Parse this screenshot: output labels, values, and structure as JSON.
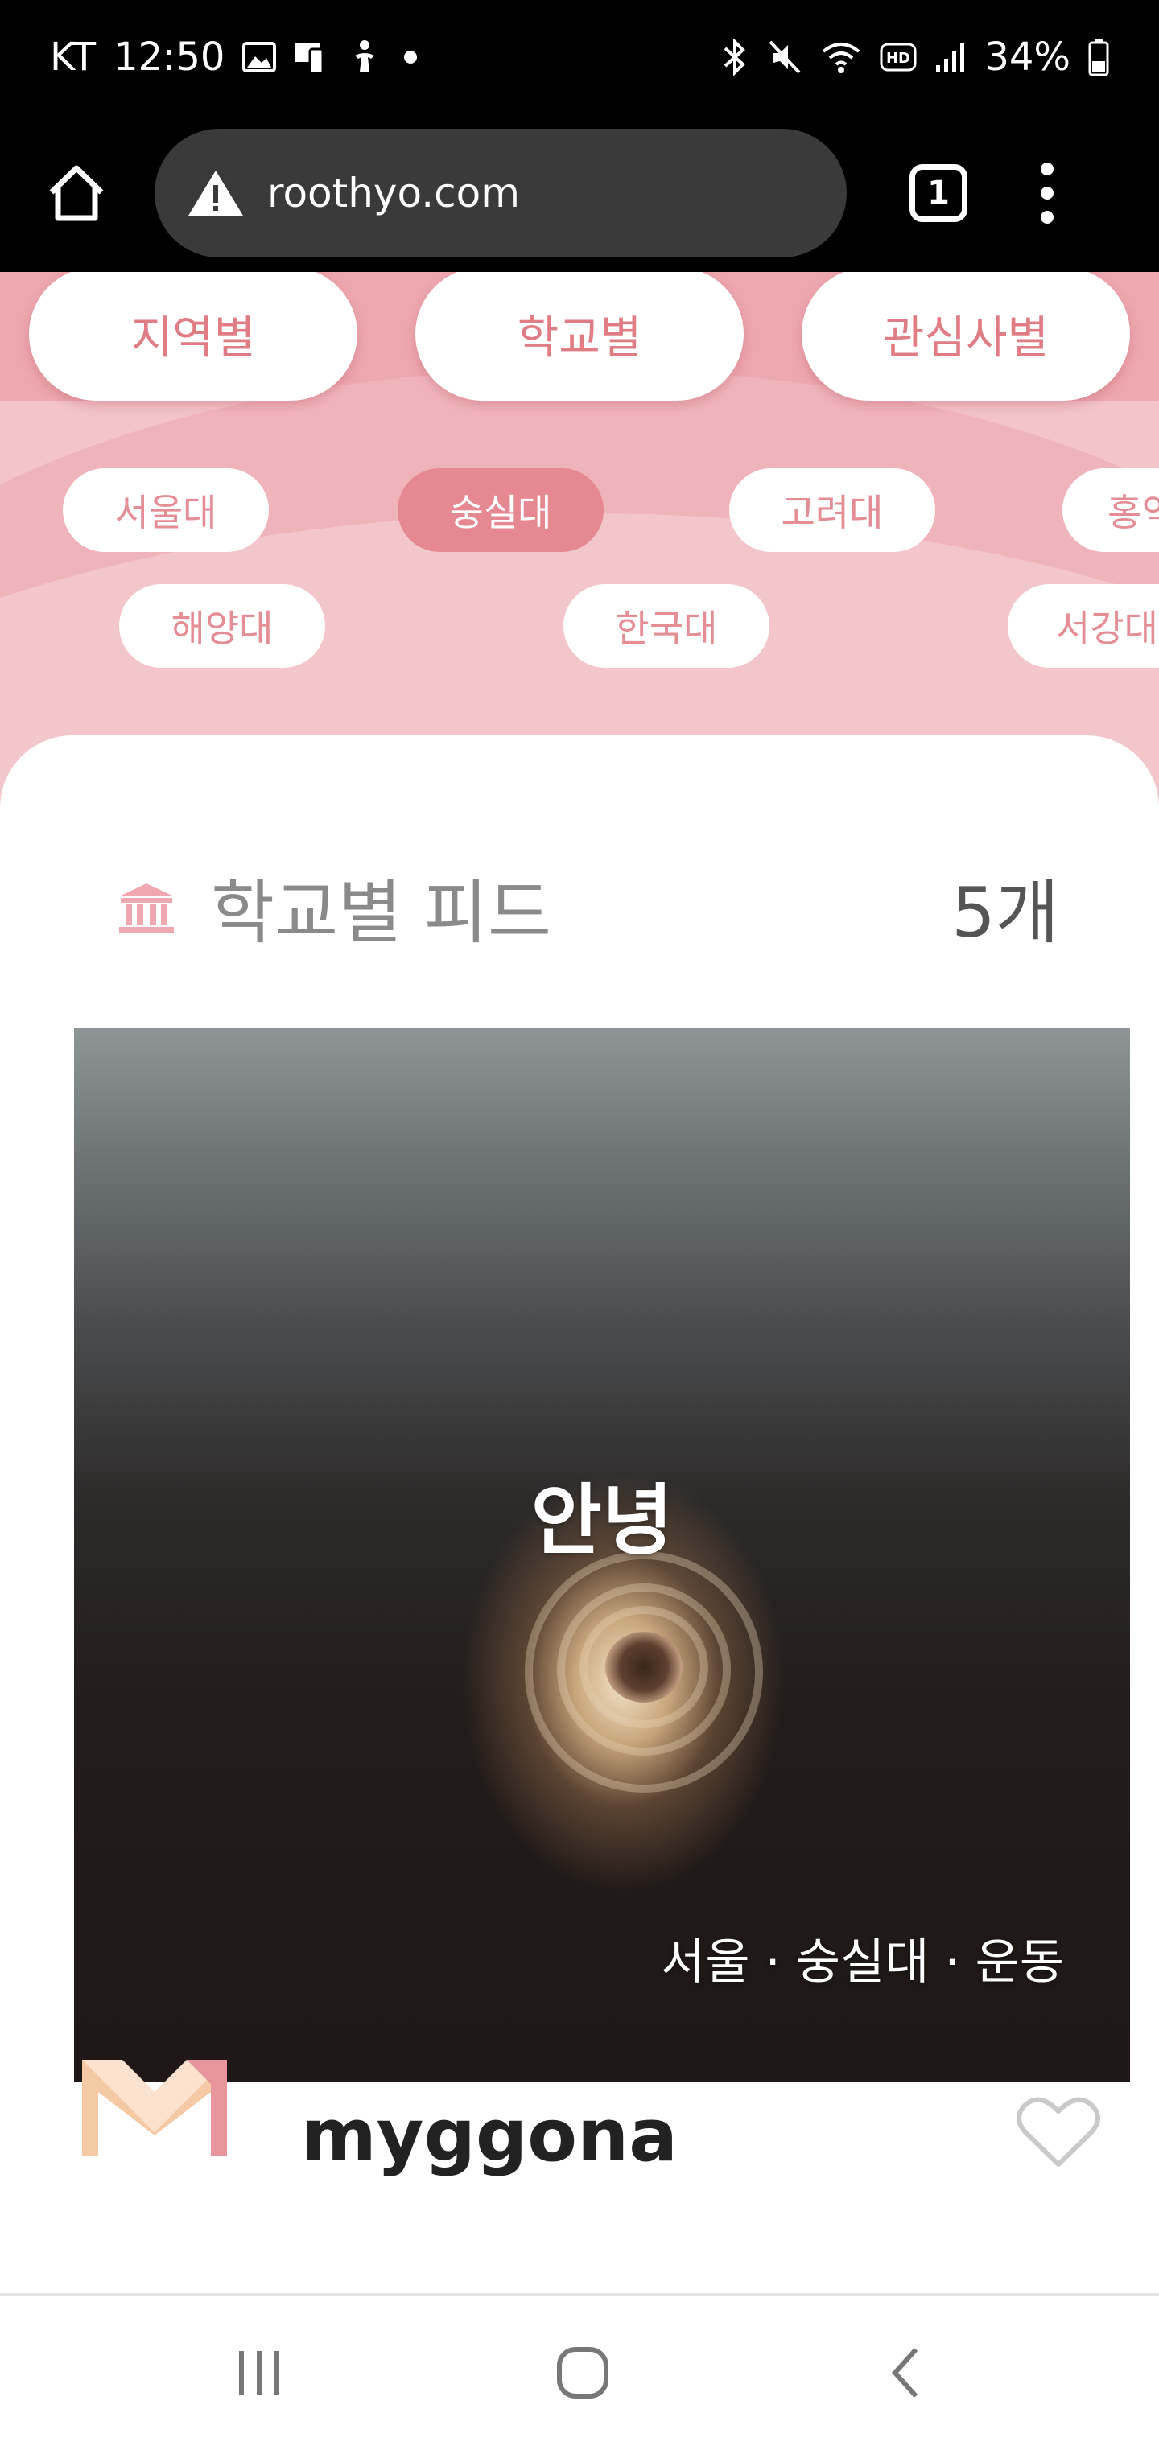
{
  "status_bar": {
    "carrier": "KT",
    "time": "12:50",
    "battery": "34%",
    "left_icons": [
      "gallery-icon",
      "screen-mirror-icon",
      "accessibility-icon",
      "notification-dot-icon"
    ],
    "right_icons": [
      "bluetooth-icon",
      "mute-icon",
      "wifi-icon",
      "hd-icon",
      "signal-icon",
      "battery-icon"
    ]
  },
  "browser": {
    "url": "roothyo.com",
    "tab_count": "1"
  },
  "filters": {
    "tabs": [
      {
        "label": "지역별"
      },
      {
        "label": "학교별"
      },
      {
        "label": "관심사별"
      }
    ],
    "chips": [
      {
        "label": "서울대",
        "active": false
      },
      {
        "label": "숭실대",
        "active": true
      },
      {
        "label": "고려대",
        "active": false
      },
      {
        "label": "홍익",
        "active": false
      },
      {
        "label": "해양대",
        "active": false
      },
      {
        "label": "한국대",
        "active": false
      },
      {
        "label": "서강대",
        "active": false
      }
    ]
  },
  "feed": {
    "title": "학교별 피드",
    "count": "5개",
    "post": {
      "title": "안녕",
      "tags": "서울 · 숭실대 · 운동",
      "author": "myggona"
    }
  },
  "colors": {
    "brand_pink": "#e68891",
    "pink_background": "#f3c4c8",
    "chip_text": "#e48d95"
  }
}
